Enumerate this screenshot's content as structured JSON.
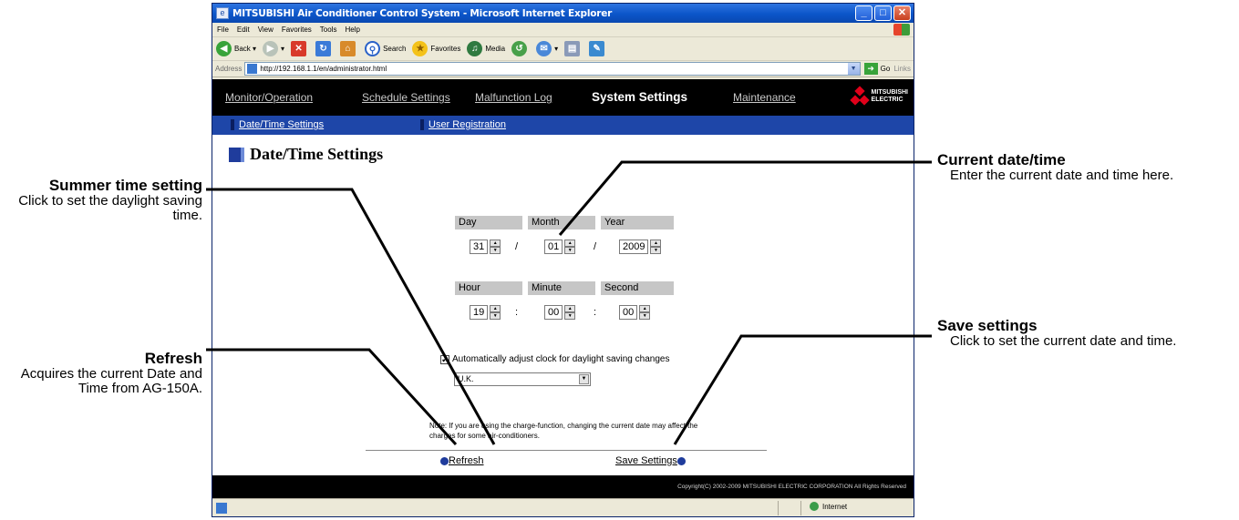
{
  "callouts": {
    "summer": {
      "title": "Summer time setting",
      "desc": "Click to set the daylight saving time."
    },
    "refresh": {
      "title": "Refresh",
      "desc": "Acquires the current Date and Time from AG-150A."
    },
    "current": {
      "title": "Current date/time",
      "desc": "Enter the current date and time here."
    },
    "save": {
      "title": "Save settings",
      "desc": "Click to set the current date and time."
    }
  },
  "browser": {
    "title": "MITSUBISHI Air Conditioner Control System - Microsoft Internet Explorer",
    "menu": [
      "File",
      "Edit",
      "View",
      "Favorites",
      "Tools",
      "Help"
    ],
    "toolbar": {
      "back": "Back",
      "search": "Search",
      "favorites": "Favorites",
      "media": "Media"
    },
    "address_label": "Address",
    "address": "http://192.168.1.1/en/administrator.html",
    "go": "Go",
    "links": "Links",
    "status_zone": "Internet"
  },
  "nav": {
    "monitor": "Monitor/Operation",
    "schedule": "Schedule Settings",
    "malfunction": "Malfunction Log",
    "system": "System Settings",
    "maintenance": "Maintenance",
    "logo_line1": "MITSUBISHI",
    "logo_line2": "ELECTRIC"
  },
  "subnav": {
    "datetime": "Date/Time Settings",
    "user": "User Registration"
  },
  "page_title": "Date/Time Settings",
  "datetime": {
    "labels": {
      "day": "Day",
      "month": "Month",
      "year": "Year",
      "hour": "Hour",
      "minute": "Minute",
      "second": "Second"
    },
    "values": {
      "day": "31",
      "month": "01",
      "year": "2009",
      "hour": "19",
      "minute": "00",
      "second": "00"
    },
    "date_sep": "/",
    "time_sep": ":"
  },
  "dst": {
    "checked": true,
    "check_mark": "✔",
    "label": "Automatically adjust clock for daylight saving changes",
    "region": "U.K."
  },
  "note": "Note: If you are using the charge-function, changing the current date may affect the charges for some air-conditioners.",
  "actions": {
    "refresh": "Refresh",
    "save": "Save Settings"
  },
  "footer": "Copyright(C) 2002-2009 MITSUBISHI ELECTRIC CORPORATION All Rights Reserved"
}
